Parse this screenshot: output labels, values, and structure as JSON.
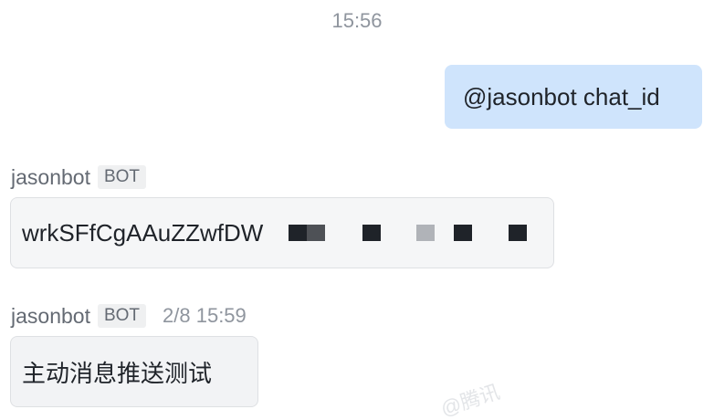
{
  "chat": {
    "timestamp": "15:56",
    "outgoing": {
      "text": "@jasonbot chat_id"
    },
    "messages": [
      {
        "sender": "jasonbot",
        "tag": "BOT",
        "time": "",
        "text": "wrkSFfCgAAuZZwfDW"
      },
      {
        "sender": "jasonbot",
        "tag": "BOT",
        "time": "2/8 15:59",
        "text": "主动消息推送测试"
      }
    ],
    "redaction_colors": [
      "#1f2329",
      "#4e5156",
      "#1f2329",
      "#b0b3b8",
      "#1f2329",
      "#1f2329"
    ],
    "watermark": "@腾讯"
  },
  "colors": {
    "outgoing_bubble": "#cfe4fc",
    "incoming_bubble": "#f5f6f7",
    "bot_tag_bg": "#eff0f1",
    "muted_text": "#8f959e"
  }
}
